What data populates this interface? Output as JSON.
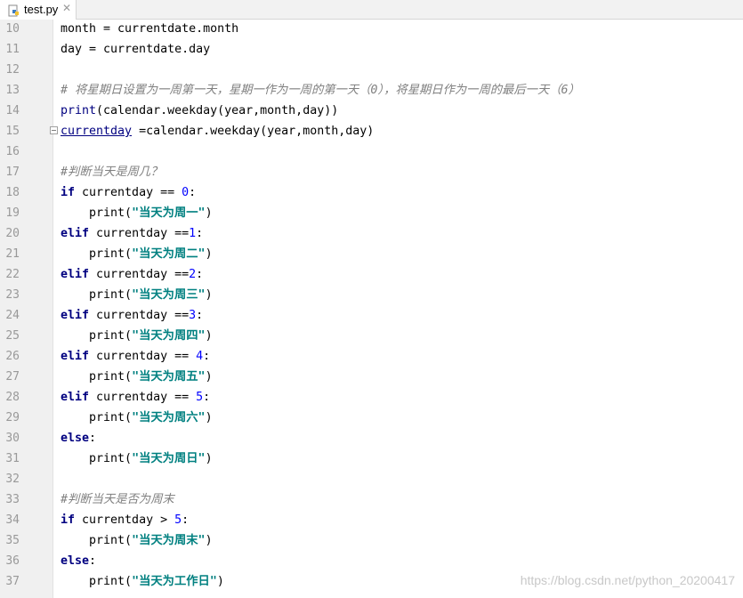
{
  "tab": {
    "filename": "test.py",
    "close_glyph": "✕",
    "icon": "python-file-icon"
  },
  "colors": {
    "keyword": "#000080",
    "number": "#0000ff",
    "string": "#008080",
    "comment": "#808080",
    "gutter": "#f0f0f0"
  },
  "lines": [
    {
      "n": "10",
      "parts": [
        {
          "t": "month = currentdate.month",
          "c": ""
        }
      ]
    },
    {
      "n": "11",
      "parts": [
        {
          "t": "day = currentdate.day",
          "c": ""
        }
      ]
    },
    {
      "n": "12",
      "parts": []
    },
    {
      "n": "13",
      "parts": [
        {
          "t": "# 将星期日设置为一周第一天，星期一作为一周的第一天（0），将星期日作为一周的最后一天（6）",
          "c": "cmt"
        }
      ]
    },
    {
      "n": "14",
      "parts": [
        {
          "t": "print",
          "c": "bi"
        },
        {
          "t": "(calendar.weekday(year,month,day))",
          "c": ""
        }
      ]
    },
    {
      "n": "15",
      "fold": true,
      "parts": [
        {
          "t": "currentday",
          "c": "und"
        },
        {
          "t": " =calendar.weekday(year,month,day)",
          "c": ""
        }
      ]
    },
    {
      "n": "16",
      "parts": []
    },
    {
      "n": "17",
      "parts": [
        {
          "t": "#判断当天是周几？",
          "c": "cmt"
        }
      ]
    },
    {
      "n": "18",
      "parts": [
        {
          "t": "if",
          "c": "kw"
        },
        {
          "t": " currentday == ",
          "c": ""
        },
        {
          "t": "0",
          "c": "num"
        },
        {
          "t": ":",
          "c": ""
        }
      ]
    },
    {
      "n": "19",
      "parts": [
        {
          "t": "    print(",
          "c": ""
        },
        {
          "t": "\"当天为周一\"",
          "c": "str"
        },
        {
          "t": ")",
          "c": ""
        }
      ]
    },
    {
      "n": "20",
      "parts": [
        {
          "t": "elif",
          "c": "kw"
        },
        {
          "t": " currentday ==",
          "c": ""
        },
        {
          "t": "1",
          "c": "num"
        },
        {
          "t": ":",
          "c": ""
        }
      ]
    },
    {
      "n": "21",
      "parts": [
        {
          "t": "    print(",
          "c": ""
        },
        {
          "t": "\"当天为周二\"",
          "c": "str"
        },
        {
          "t": ")",
          "c": ""
        }
      ]
    },
    {
      "n": "22",
      "parts": [
        {
          "t": "elif",
          "c": "kw"
        },
        {
          "t": " currentday ==",
          "c": ""
        },
        {
          "t": "2",
          "c": "num"
        },
        {
          "t": ":",
          "c": ""
        }
      ]
    },
    {
      "n": "23",
      "parts": [
        {
          "t": "    print(",
          "c": ""
        },
        {
          "t": "\"当天为周三\"",
          "c": "str"
        },
        {
          "t": ")",
          "c": ""
        }
      ]
    },
    {
      "n": "24",
      "parts": [
        {
          "t": "elif",
          "c": "kw"
        },
        {
          "t": " currentday ==",
          "c": ""
        },
        {
          "t": "3",
          "c": "num"
        },
        {
          "t": ":",
          "c": ""
        }
      ]
    },
    {
      "n": "25",
      "parts": [
        {
          "t": "    print(",
          "c": ""
        },
        {
          "t": "\"当天为周四\"",
          "c": "str"
        },
        {
          "t": ")",
          "c": ""
        }
      ]
    },
    {
      "n": "26",
      "parts": [
        {
          "t": "elif",
          "c": "kw"
        },
        {
          "t": " currentday == ",
          "c": ""
        },
        {
          "t": "4",
          "c": "num"
        },
        {
          "t": ":",
          "c": ""
        }
      ]
    },
    {
      "n": "27",
      "parts": [
        {
          "t": "    print(",
          "c": ""
        },
        {
          "t": "\"当天为周五\"",
          "c": "str"
        },
        {
          "t": ")",
          "c": ""
        }
      ]
    },
    {
      "n": "28",
      "parts": [
        {
          "t": "elif",
          "c": "kw"
        },
        {
          "t": " currentday == ",
          "c": ""
        },
        {
          "t": "5",
          "c": "num"
        },
        {
          "t": ":",
          "c": ""
        }
      ]
    },
    {
      "n": "29",
      "parts": [
        {
          "t": "    print(",
          "c": ""
        },
        {
          "t": "\"当天为周六\"",
          "c": "str"
        },
        {
          "t": ")",
          "c": ""
        }
      ]
    },
    {
      "n": "30",
      "parts": [
        {
          "t": "else",
          "c": "kw"
        },
        {
          "t": ":",
          "c": ""
        }
      ]
    },
    {
      "n": "31",
      "parts": [
        {
          "t": "    print(",
          "c": ""
        },
        {
          "t": "\"当天为周日\"",
          "c": "str"
        },
        {
          "t": ")",
          "c": ""
        }
      ]
    },
    {
      "n": "32",
      "parts": []
    },
    {
      "n": "33",
      "parts": [
        {
          "t": "#判断当天是否为周末",
          "c": "cmt"
        }
      ]
    },
    {
      "n": "34",
      "parts": [
        {
          "t": "if",
          "c": "kw"
        },
        {
          "t": " currentday > ",
          "c": ""
        },
        {
          "t": "5",
          "c": "num"
        },
        {
          "t": ":",
          "c": ""
        }
      ]
    },
    {
      "n": "35",
      "parts": [
        {
          "t": "    print(",
          "c": ""
        },
        {
          "t": "\"当天为周末\"",
          "c": "str"
        },
        {
          "t": ")",
          "c": ""
        }
      ]
    },
    {
      "n": "36",
      "parts": [
        {
          "t": "else",
          "c": "kw"
        },
        {
          "t": ":",
          "c": ""
        }
      ]
    },
    {
      "n": "37",
      "parts": [
        {
          "t": "    print(",
          "c": ""
        },
        {
          "t": "\"当天为工作日\"",
          "c": "str"
        },
        {
          "t": ")",
          "c": ""
        }
      ]
    }
  ],
  "watermark": "https://blog.csdn.net/python_20200417"
}
